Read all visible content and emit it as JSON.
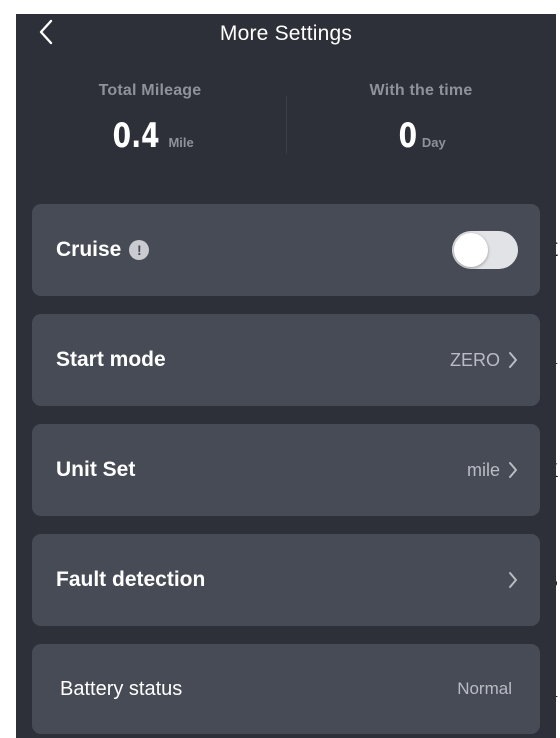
{
  "header": {
    "title": "More Settings",
    "back_icon": "chevron-left-icon"
  },
  "stats": {
    "mileage": {
      "label": "Total Mileage",
      "value": "0.4",
      "unit": "Mile"
    },
    "time": {
      "label": "With the time",
      "value": "0",
      "unit": "Day"
    }
  },
  "settings": {
    "cruise": {
      "label": "Cruise",
      "info_icon": "!",
      "enabled": false
    },
    "start_mode": {
      "label": "Start mode",
      "value": "ZERO"
    },
    "unit_set": {
      "label": "Unit Set",
      "value": "mile"
    },
    "fault_detection": {
      "label": "Fault detection",
      "value": ""
    },
    "battery_status": {
      "label": "Battery status",
      "value": "Normal"
    }
  },
  "background_edge_text": {
    "right": [
      "t",
      "l",
      "k",
      "s",
      "n"
    ]
  },
  "colors": {
    "app_background": "#2d3038",
    "card_background": "#474b55",
    "label_gray": "#8e929b",
    "toggle_off": "#e2e3e6"
  }
}
